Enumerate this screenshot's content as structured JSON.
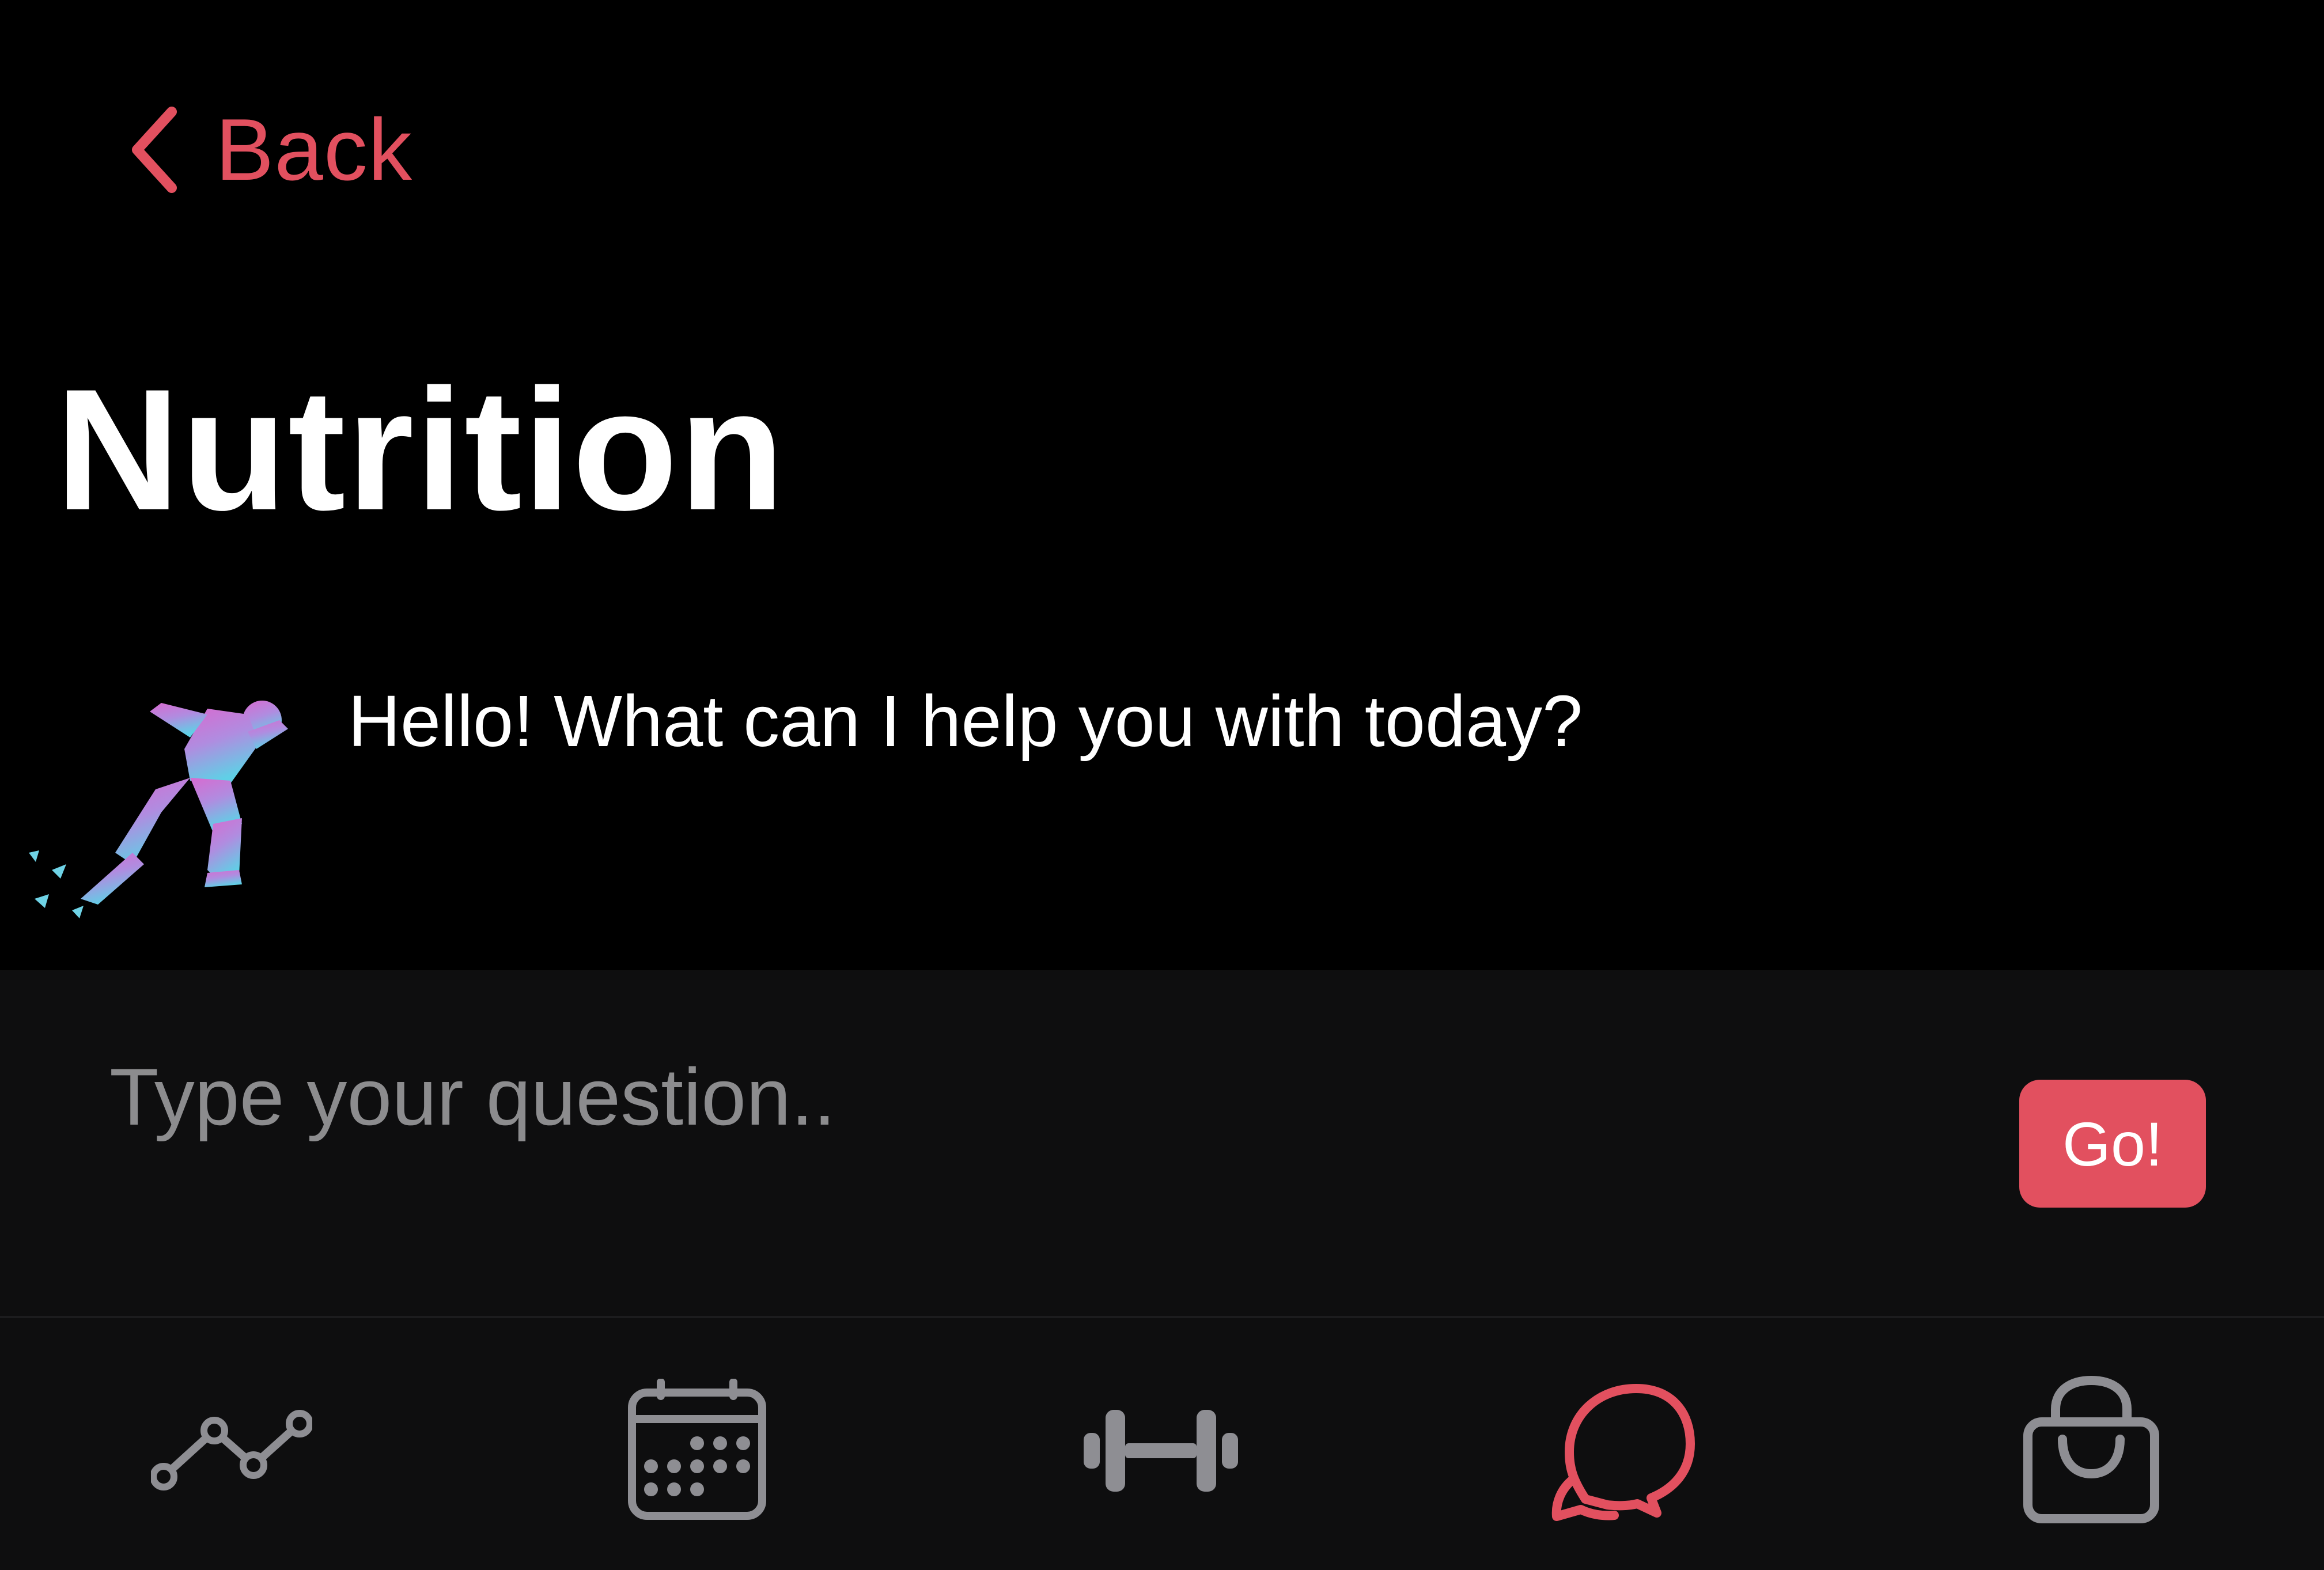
{
  "header": {
    "back_label": "Back",
    "back_icon": "chevron-left-icon",
    "title": "Nutrition"
  },
  "chat": {
    "avatar_icon": "sprinter-avatar-icon",
    "greeting": "Hello! What can I help you with today?"
  },
  "composer": {
    "placeholder": "Type your question..",
    "value": "",
    "submit_label": "Go!"
  },
  "tab_bar": {
    "tabs": [
      {
        "icon": "line-chart-icon",
        "active": false
      },
      {
        "icon": "calendar-icon",
        "active": false
      },
      {
        "icon": "dumbbell-icon",
        "active": false
      },
      {
        "icon": "chat-bubbles-icon",
        "active": true
      },
      {
        "icon": "shopping-bag-icon",
        "active": false
      }
    ]
  },
  "colors": {
    "accent": "#e2505f",
    "background": "#000000",
    "panel": "#0e0e0f",
    "inactive_icon": "#8e8e93",
    "placeholder": "#8c8c8e",
    "text": "#ffffff"
  }
}
